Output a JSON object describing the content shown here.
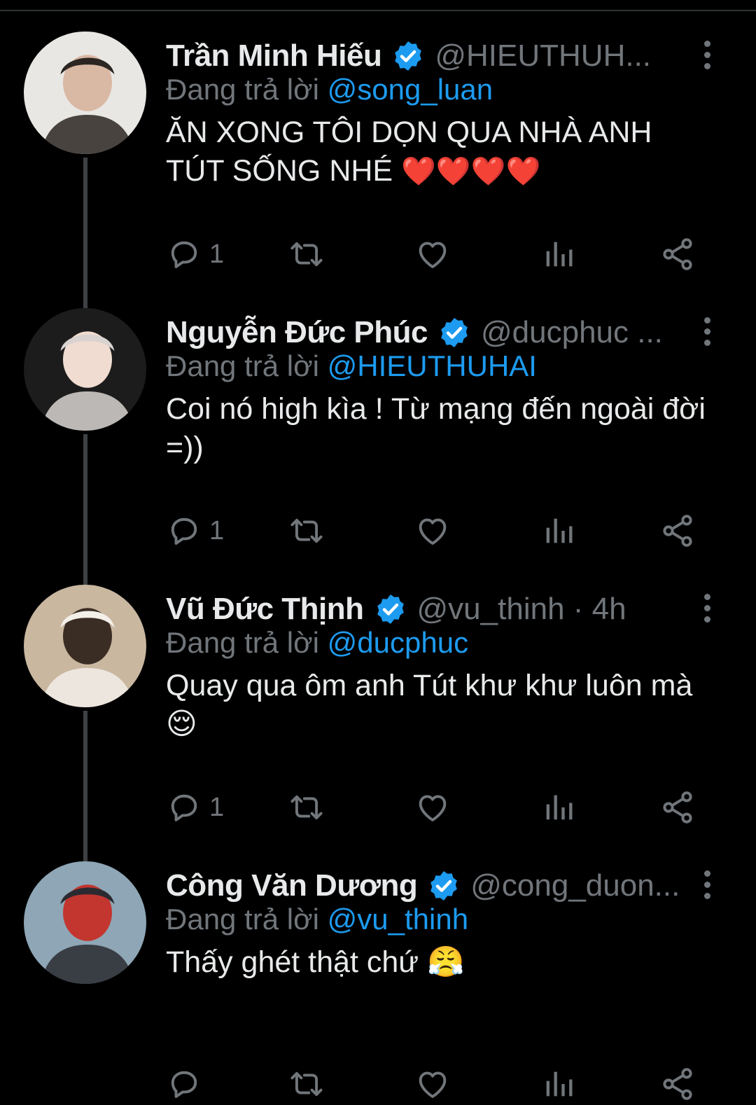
{
  "tweets": [
    {
      "name": "Trần Minh Hiếu",
      "handle": "@HIEUTHUH...",
      "reply_prefix": "Đang trả lời ",
      "reply_to": "@song_luan",
      "text": "ĂN XONG TÔI DỌN QUA NHÀ ANH TÚT SỐNG NHÉ ",
      "emoji": "❤️❤️❤️❤️",
      "reply_count": "1",
      "avatar_colors": [
        "#e9e7e4",
        "#2b2622",
        "#d9b8a4"
      ]
    },
    {
      "name": "Nguyễn Đức Phúc",
      "handle": "@ducphuc ...",
      "reply_prefix": "Đang trả lời ",
      "reply_to": "@HIEUTHUHAI",
      "text": "Coi nó high kìa ! Từ mạng đến ngoài đời =))",
      "emoji": "",
      "reply_count": "1",
      "avatar_colors": [
        "#1c1c1c",
        "#d8d3d0",
        "#f1dcd1"
      ]
    },
    {
      "name": "Vũ Đức Thịnh",
      "handle": "@vu_thinh · 4h",
      "reply_prefix": "Đang trả lời ",
      "reply_to": "@ducphuc",
      "text": "Quay qua ôm anh Tút khư khư luôn mà ",
      "emoji": "😌",
      "reply_count": "1",
      "avatar_colors": [
        "#c9b7a0",
        "#f3efe9",
        "#3a2d24"
      ]
    },
    {
      "name": "Công Văn Dương",
      "handle": "@cong_duon...",
      "reply_prefix": "Đang trả lời ",
      "reply_to": "@vu_thinh",
      "text": "Thấy ghét thật chứ ",
      "emoji": "😤",
      "reply_count": "",
      "avatar_colors": [
        "#8ea6b5",
        "#2a2a30",
        "#c2362f"
      ]
    }
  ],
  "icons": {
    "reply": "reply-icon",
    "retweet": "retweet-icon",
    "like": "heart-icon",
    "views": "analytics-icon",
    "share": "share-icon",
    "verified": "verified-badge-icon",
    "more": "more-vertical-icon"
  },
  "colors": {
    "background": "#000000",
    "text": "#e7e9ea",
    "muted": "#71767b",
    "accent": "#1d9bf0",
    "thread_line": "#3e4144"
  }
}
